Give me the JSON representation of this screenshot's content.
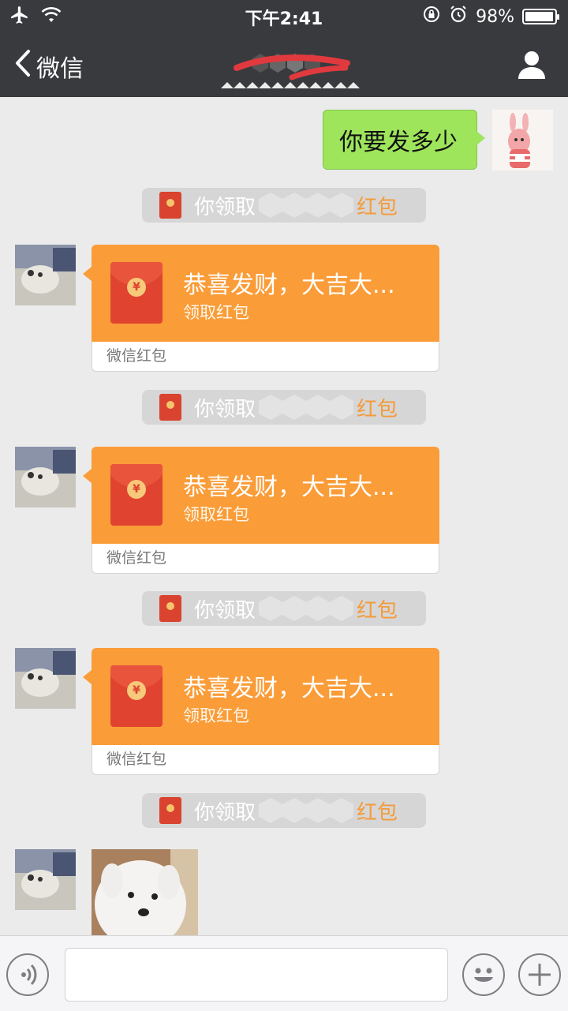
{
  "status_bar": {
    "time": "下午2:41",
    "battery_text": "98%",
    "battery_level": 0.98,
    "icons": [
      "airplane-icon",
      "wifi-icon",
      "rotation-lock-icon",
      "alarm-icon",
      "battery-icon"
    ]
  },
  "nav": {
    "back_label": "微信",
    "title": "",
    "icons": [
      "chevron-left-icon",
      "person-icon"
    ]
  },
  "messages": {
    "sent_text": "你要发多少",
    "system_notes": [
      {
        "prefix": "你领取",
        "suffix": "红包"
      },
      {
        "prefix": "你领取",
        "suffix": "红包"
      },
      {
        "prefix": "你领取",
        "suffix": "红包"
      },
      {
        "prefix": "你领取",
        "suffix": "红包"
      }
    ],
    "red_packets": [
      {
        "title": "恭喜发财，大吉大...",
        "subtitle": "领取红包",
        "footer": "微信红包"
      },
      {
        "title": "恭喜发财，大吉大...",
        "subtitle": "领取红包",
        "footer": "微信红包"
      },
      {
        "title": "恭喜发财，大吉大...",
        "subtitle": "领取红包",
        "footer": "微信红包"
      }
    ],
    "coin_symbol": "¥"
  },
  "input_bar": {
    "value": "",
    "icons": [
      "voice-icon",
      "emoji-icon",
      "plus-icon"
    ]
  },
  "colors": {
    "nav_bg": "#393a3e",
    "chat_bg": "#ebebeb",
    "sent_bubble": "#9ee55c",
    "red_packet": "#fa9c38",
    "link_orange": "#f49b3a"
  }
}
